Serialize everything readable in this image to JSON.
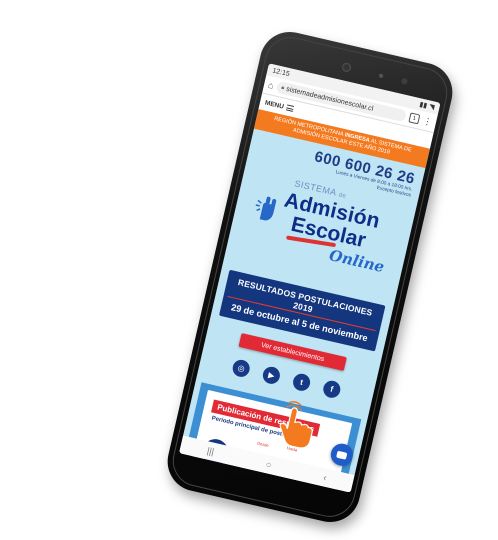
{
  "status": {
    "time": "12:15"
  },
  "browser": {
    "url": "sistemadeadmisionescolar.cl",
    "tab_count": "1"
  },
  "menu": {
    "label": "MENU"
  },
  "banner": {
    "line1_pre": "REGIÓN METROPOLITANA ",
    "line1_bold": "INGRESA",
    "line1_post": " AL SISTEMA DE",
    "line2": "ADMISIÓN ESCOLAR ESTE AÑO 2019"
  },
  "contact": {
    "phone": "600 600 26 26",
    "hours": "Lunes a Viernes de 8:00 a 18:00 hrs.",
    "exceptions": "Excepto festivos"
  },
  "logo": {
    "sistema": "SISTEMA",
    "de": "de",
    "admision": "Admisión",
    "escolar": "Escolar",
    "online": "Online"
  },
  "results": {
    "title": "RESULTADOS POSTULACIONES 2019",
    "dates": "29 de octubre al 5 de noviembre"
  },
  "cta": {
    "label": "Ver establecimientos"
  },
  "socials": [
    {
      "icon": "instagram-icon",
      "glyph": "◎"
    },
    {
      "icon": "youtube-icon",
      "glyph": "▶"
    },
    {
      "icon": "twitter-icon",
      "glyph": "t"
    },
    {
      "icon": "facebook-icon",
      "glyph": "f"
    }
  ],
  "publication": {
    "title": "Publicación de resultados",
    "subtitle": "Período principal de postulación",
    "desde": "Desde",
    "hasta": "Hasta"
  },
  "nav": {
    "recents": "|||",
    "home": "○",
    "back": "‹"
  },
  "colors": {
    "orange": "#f47a20",
    "navy": "#13367e",
    "red": "#e22a36",
    "sky": "#bfe4f3",
    "pointer": "#f47a20"
  }
}
